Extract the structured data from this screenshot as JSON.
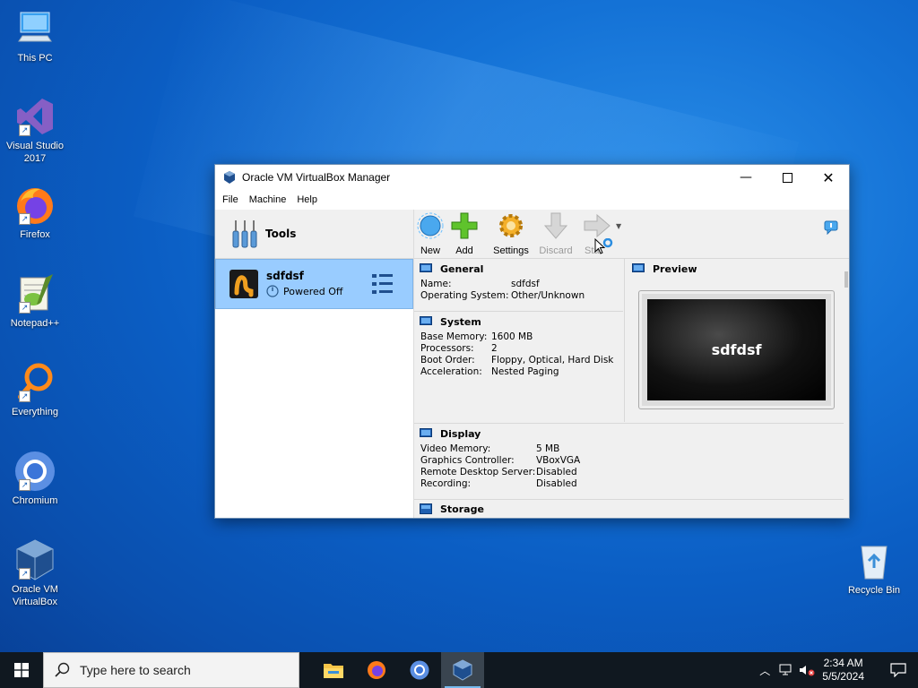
{
  "desktop": {
    "icons": [
      {
        "label": "This PC"
      },
      {
        "label": "Visual Studio 2017"
      },
      {
        "label": "Firefox"
      },
      {
        "label": "Notepad++"
      },
      {
        "label": "Everything"
      },
      {
        "label": "Chromium"
      },
      {
        "label": "Oracle VM VirtualBox"
      },
      {
        "label": "Recycle Bin"
      }
    ]
  },
  "window": {
    "title": "Oracle VM VirtualBox Manager",
    "menu": [
      "File",
      "Machine",
      "Help"
    ],
    "tools_label": "Tools",
    "vm": {
      "name": "sdfdsf",
      "state": "Powered Off"
    },
    "toolbar": {
      "new": "New",
      "add": "Add",
      "settings": "Settings",
      "discard": "Discard",
      "start": "Start"
    },
    "general": {
      "title": "General",
      "rows": [
        {
          "k": "Name:",
          "v": "sdfdsf"
        },
        {
          "k": "Operating System:",
          "v": "Other/Unknown"
        }
      ]
    },
    "system": {
      "title": "System",
      "rows": [
        {
          "k": "Base Memory:",
          "v": "1600 MB"
        },
        {
          "k": "Processors:",
          "v": "2"
        },
        {
          "k": "Boot Order:",
          "v": "Floppy, Optical, Hard Disk"
        },
        {
          "k": "Acceleration:",
          "v": "Nested Paging"
        }
      ]
    },
    "preview": {
      "title": "Preview",
      "screen_text": "sdfdsf"
    },
    "display": {
      "title": "Display",
      "rows": [
        {
          "k": "Video Memory:",
          "v": "5 MB"
        },
        {
          "k": "Graphics Controller:",
          "v": "VBoxVGA"
        },
        {
          "k": "Remote Desktop Server:",
          "v": "Disabled"
        },
        {
          "k": "Recording:",
          "v": "Disabled"
        }
      ]
    },
    "storage": {
      "title": "Storage"
    }
  },
  "taskbar": {
    "search_placeholder": "Type here to search",
    "time": "2:34 AM",
    "date": "5/5/2024"
  },
  "colors": {
    "accent": "#99ccff",
    "taskbar": "#101820",
    "desktop": "#0b5ec4"
  }
}
